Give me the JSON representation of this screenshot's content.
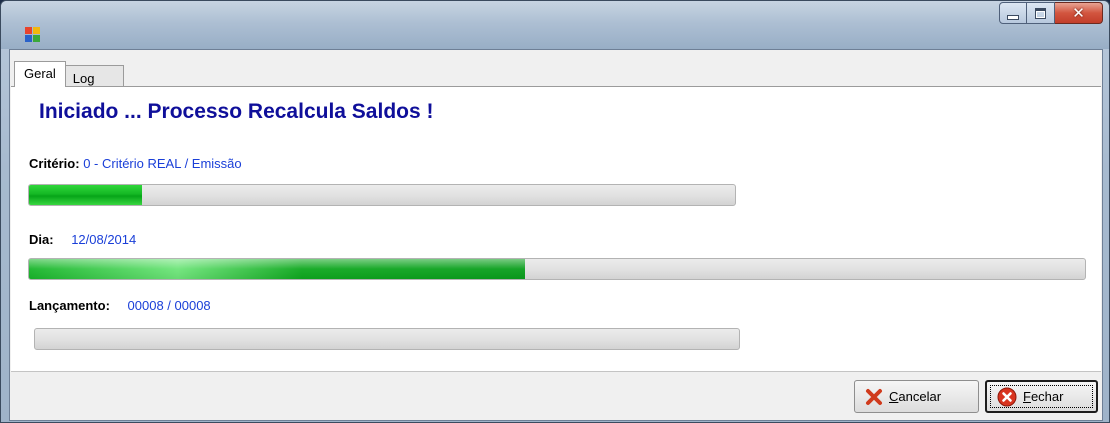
{
  "window": {
    "title": ""
  },
  "icons": {
    "app": "app-icon",
    "minimize": "minimize-icon",
    "maximize": "maximize-icon",
    "close": "close-icon",
    "cancel": "cancel-x-icon",
    "fechar": "close-circle-icon"
  },
  "tabs": [
    {
      "label": "Geral",
      "active": true
    },
    {
      "label": "Log",
      "active": false
    }
  ],
  "main": {
    "heading": "Iniciado ... Processo Recalcula Saldos !",
    "criterio": {
      "label": "Critério:",
      "value": "0 - Critério REAL / Emissão",
      "progress": 0.16
    },
    "dia": {
      "label": "Dia:",
      "value": "12/08/2014",
      "progress": 0.47
    },
    "lancamento": {
      "label": "Lançamento:",
      "value": "00008 / 00008",
      "progress": 0.0
    }
  },
  "buttons": {
    "cancel": {
      "underlined": "C",
      "rest": "ancelar"
    },
    "close": {
      "underlined": "F",
      "rest": "echar"
    }
  },
  "colors": {
    "heading": "#0f0f9a",
    "value_text": "#1a3fd8",
    "progress_fill": "#14b824"
  }
}
